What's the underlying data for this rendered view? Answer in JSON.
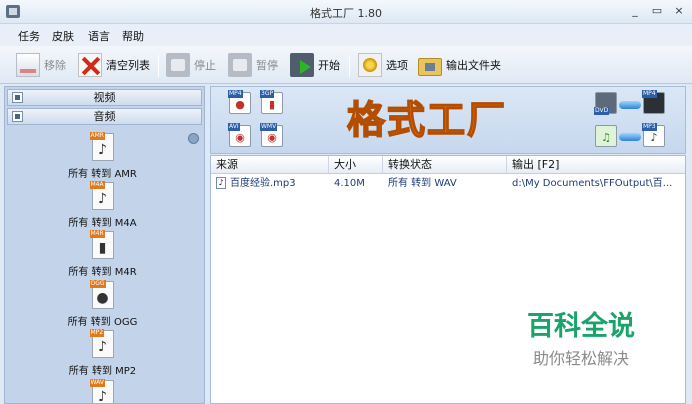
{
  "window": {
    "title": "格式工厂 1.80",
    "controls": [
      "_",
      "▭",
      "×"
    ]
  },
  "menu": [
    "任务",
    "皮肤",
    "语言",
    "帮助"
  ],
  "toolbar": {
    "remove": "移除",
    "clear_list": "清空列表",
    "stop": "停止",
    "pause": "暂停",
    "start": "开始",
    "options": "选项",
    "output_folder": "输出文件夹"
  },
  "categories": {
    "video": "视频",
    "audio": "音频"
  },
  "formats": [
    {
      "tag": "AMR",
      "label": "所有 转到 AMR"
    },
    {
      "tag": "M4A",
      "label": "所有 转到 M4A"
    },
    {
      "tag": "M4R",
      "label": "所有 转到 M4R"
    },
    {
      "tag": "OGG",
      "label": "所有 转到 OGG"
    },
    {
      "tag": "MP2",
      "label": "所有 转到 MP2"
    },
    {
      "tag": "WAV",
      "label": ""
    }
  ],
  "banner": {
    "logo": "格式工厂",
    "left_icons": [
      "MP4",
      "3GP",
      "AVI",
      "WMV"
    ],
    "right_icons": [
      "MP4",
      "MP3"
    ],
    "dvd": "DVD"
  },
  "filelist": {
    "headers": [
      "来源",
      "大小",
      "转换状态",
      "输出 [F2]"
    ],
    "rows": [
      {
        "source": "百度经验.mp3",
        "size": "4.10M",
        "status": "所有 转到 WAV",
        "output": "d:\\My Documents\\FFOutput\\百..."
      }
    ]
  },
  "watermark": {
    "title": "百科全说",
    "subtitle": "助你轻松解决"
  }
}
